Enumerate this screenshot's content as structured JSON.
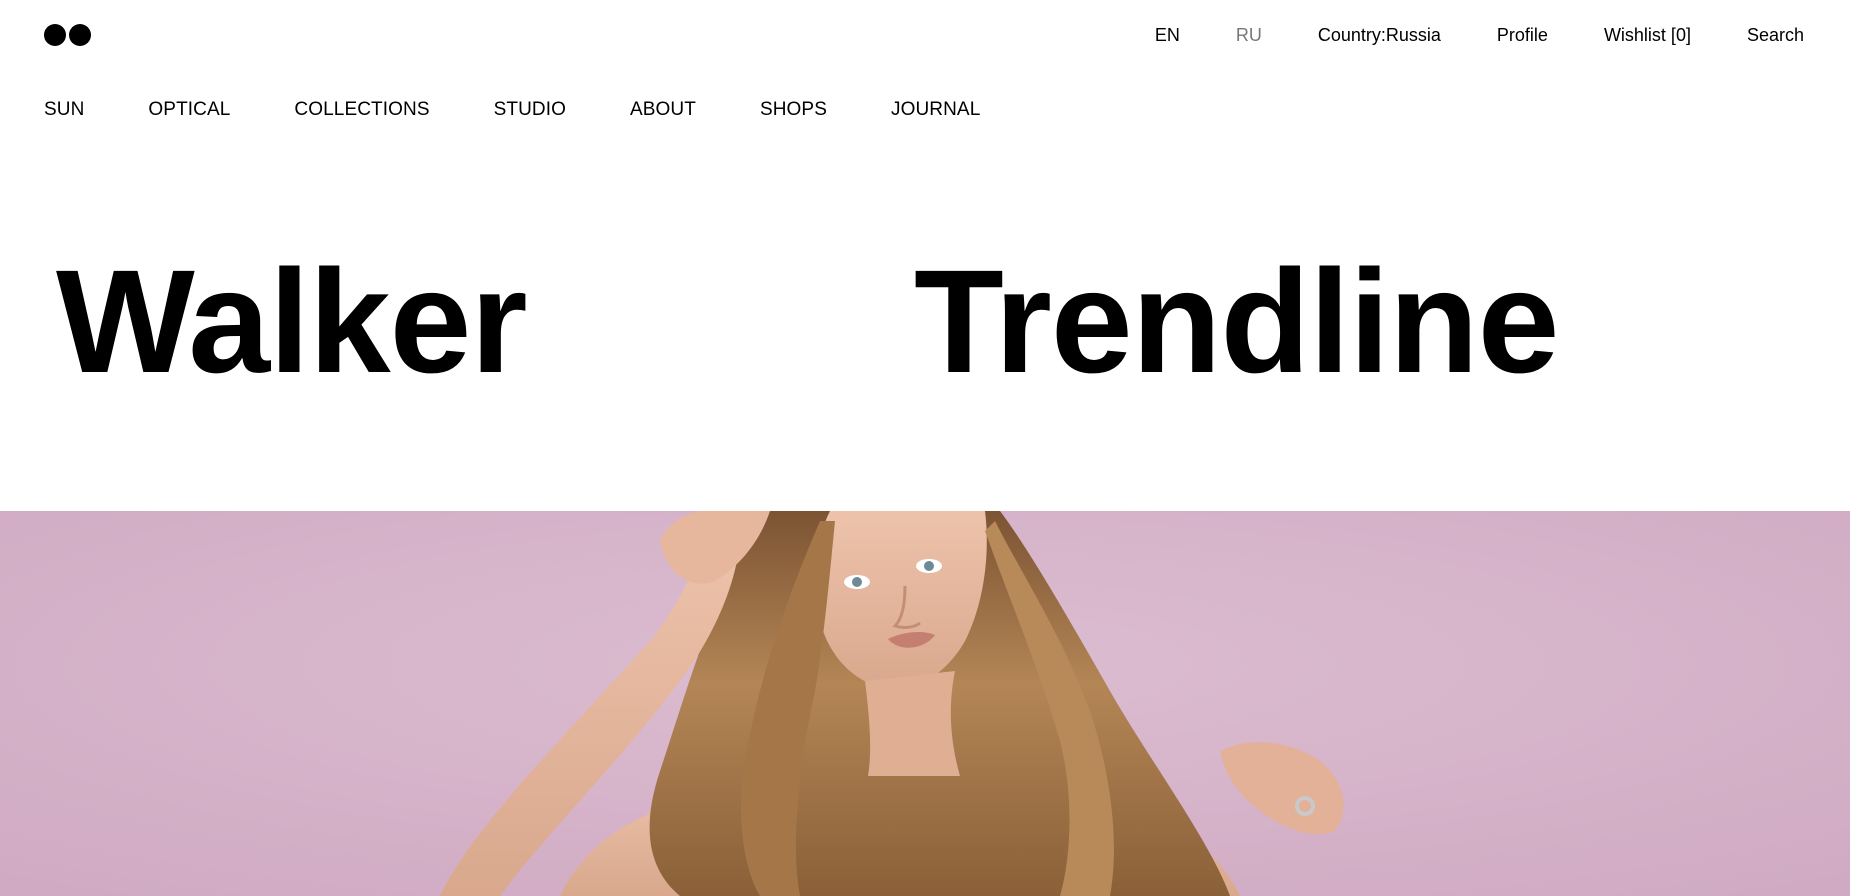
{
  "header": {
    "logo_icon": "two-black-dots-logo",
    "language": {
      "en_label": "EN",
      "ru_label": "RU",
      "active": "EN"
    },
    "country_label": "Country:Russia",
    "profile_label": "Profile",
    "wishlist_label": "Wishlist [0]",
    "search_label": "Search"
  },
  "nav": {
    "items": [
      {
        "label": "SUN"
      },
      {
        "label": "OPTICAL"
      },
      {
        "label": "COLLECTIONS"
      },
      {
        "label": "STUDIO"
      },
      {
        "label": "ABOUT"
      },
      {
        "label": "SHOPS"
      },
      {
        "label": "JOURNAL"
      }
    ]
  },
  "hero": {
    "title_left": "Walker",
    "title_right": "Trendline",
    "image_subject": "portrait-woman-long-wavy-hair-pink-wall",
    "colors": {
      "background": "#d5b3c9",
      "hair": "#a77a4a",
      "skin": "#e2b59c"
    }
  },
  "colors": {
    "page_bg": "#ffffff",
    "text": "#000000",
    "inactive_text": "#777777"
  }
}
